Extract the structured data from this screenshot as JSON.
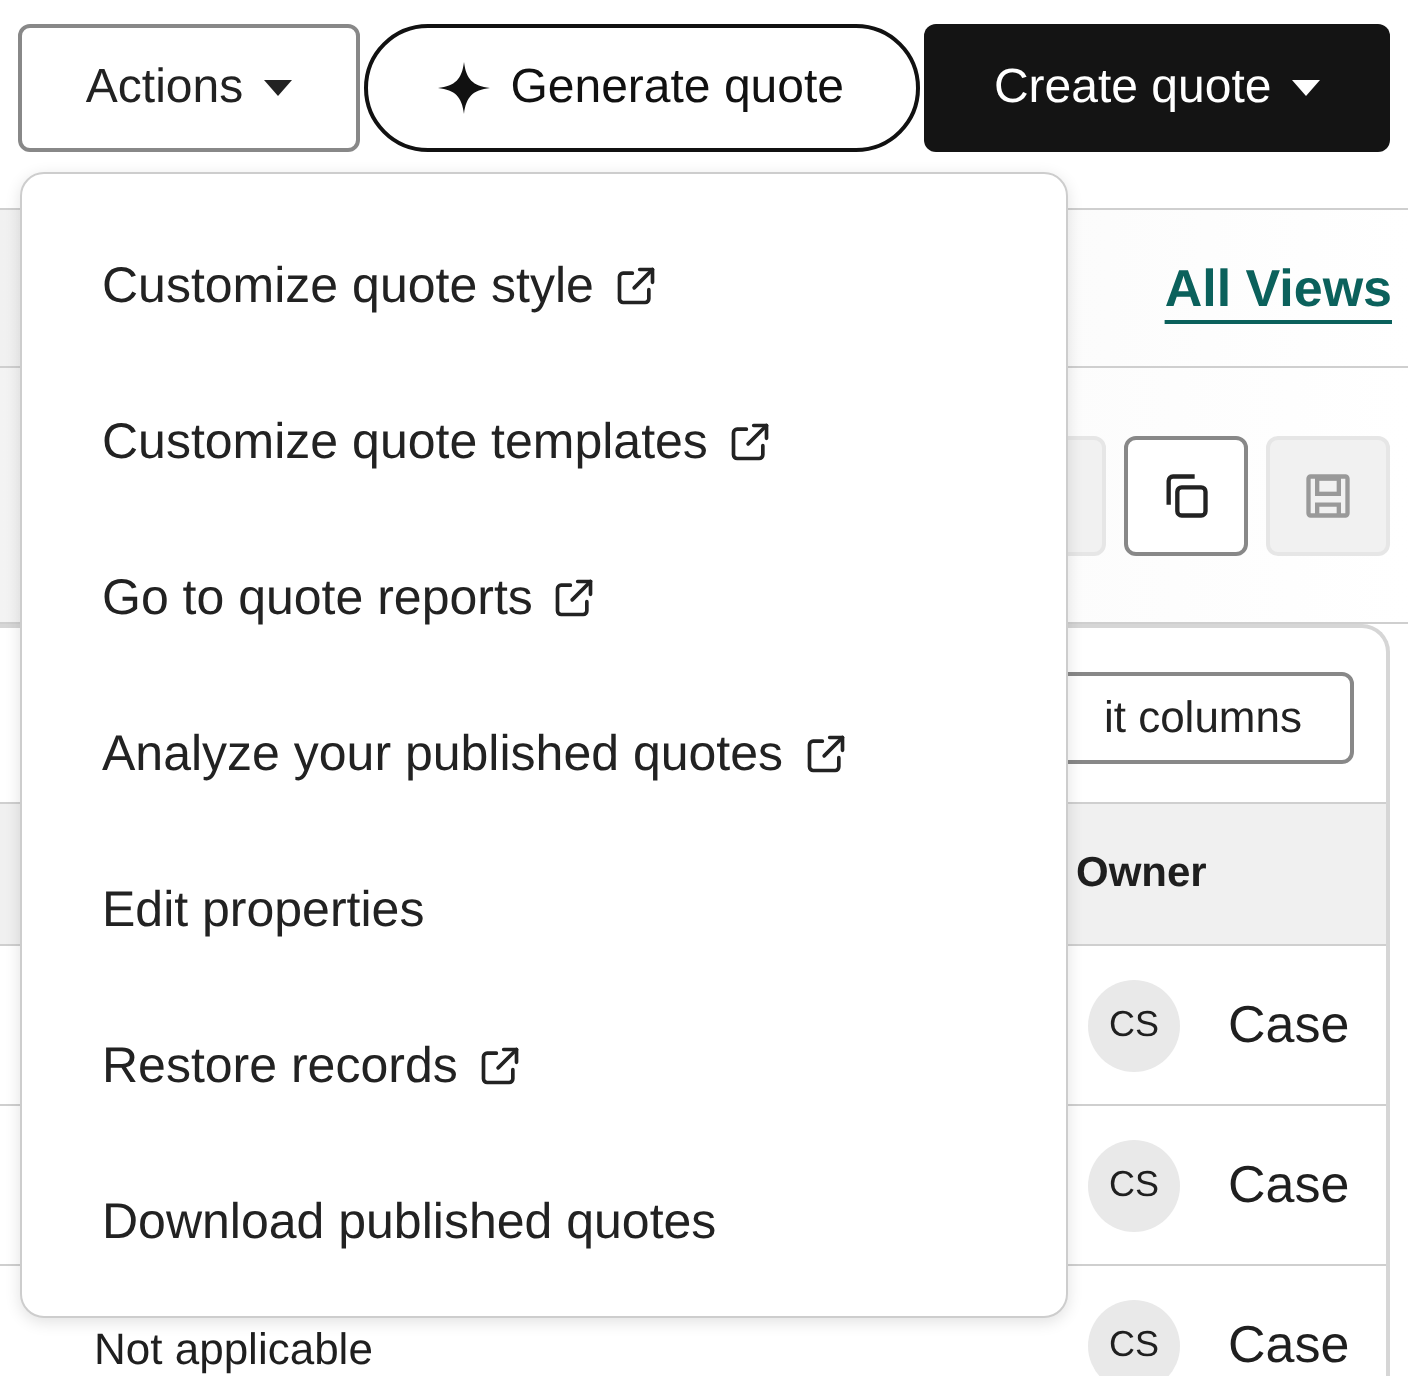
{
  "toolbar": {
    "buttons": [
      {
        "label": "Actions",
        "kind": "dropdown"
      },
      {
        "label": "Generate quote",
        "kind": "ai"
      },
      {
        "label": "Create quote",
        "kind": "primary"
      }
    ]
  },
  "views_link": "All Views",
  "view_actions": [
    {
      "kind": "blank",
      "disabled": true
    },
    {
      "kind": "copy",
      "disabled": false
    },
    {
      "kind": "save",
      "disabled": true
    }
  ],
  "edit_columns_button": "it columns",
  "table": {
    "columns": [
      "Owner"
    ],
    "rows": [
      {
        "owner_initials": "CS",
        "owner": "Case"
      },
      {
        "owner_initials": "CS",
        "owner": "Case"
      },
      {
        "column_1": "Not applicable",
        "owner_initials": "CS",
        "owner": "Case"
      }
    ]
  },
  "actions_menu": {
    "open": true,
    "items": [
      {
        "label": "Customize quote style",
        "external": true
      },
      {
        "label": "Customize quote templates",
        "external": true
      },
      {
        "label": "Go to quote reports",
        "external": true
      },
      {
        "label": "Analyze your published quotes",
        "external": true
      },
      {
        "label": "Edit properties",
        "external": false
      },
      {
        "label": "Restore records",
        "external": true
      },
      {
        "label": "Download published quotes",
        "external": false
      }
    ]
  }
}
